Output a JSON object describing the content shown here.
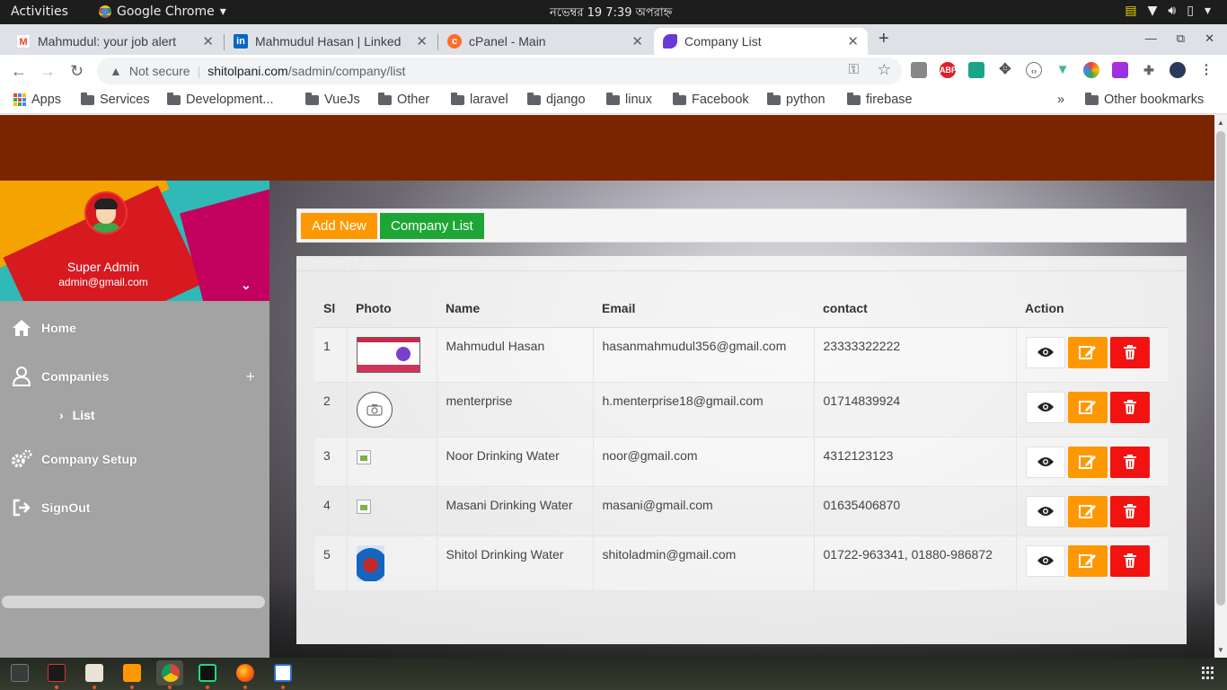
{
  "os": {
    "activities": "Activities",
    "app_menu": "Google Chrome",
    "clock": "নভেম্বর 19  7:39 অপরাহ্ন"
  },
  "tabs": [
    {
      "title": "Mahmudul: your job alert",
      "favicon": "gmail-icon"
    },
    {
      "title": "Mahmudul Hasan | Linked",
      "favicon": "linkedin-icon"
    },
    {
      "title": "cPanel - Main",
      "favicon": "cpanel-icon"
    },
    {
      "title": "Company List",
      "favicon": "site-icon",
      "active": true
    }
  ],
  "address": {
    "security": "Not secure",
    "domain": "shitolpani.com",
    "path": "/sadmin/company/list"
  },
  "bookmarks": {
    "apps": "Apps",
    "items": [
      "Services",
      "Development...",
      "VueJs",
      "Other",
      "laravel",
      "django",
      "linux",
      "Facebook",
      "python",
      "firebase"
    ],
    "overflow": "»",
    "other": "Other bookmarks"
  },
  "sidebar": {
    "user_name": "Super Admin",
    "user_email": "admin@gmail.com",
    "menu": {
      "home": "Home",
      "companies": "Companies",
      "list": "List",
      "company_setup": "Company Setup",
      "signout": "SignOut"
    }
  },
  "toolbar": {
    "add_new": "Add New",
    "company_list": "Company List"
  },
  "panel": {
    "title": "Company List"
  },
  "table": {
    "headers": {
      "sl": "Sl",
      "photo": "Photo",
      "name": "Name",
      "email": "Email",
      "contact": "contact",
      "action": "Action"
    },
    "rows": [
      {
        "sl": "1",
        "name": "Mahmudul Hasan",
        "email": "hasanmahmudul356@gmail.com",
        "contact": "23333322222",
        "photo": "website-screenshot"
      },
      {
        "sl": "2",
        "name": "menterprise",
        "email": "h.menterprise18@gmail.com",
        "contact": "01714839924",
        "photo": "camera-placeholder"
      },
      {
        "sl": "3",
        "name": "Noor Drinking Water",
        "email": "noor@gmail.com",
        "contact": "4312123123",
        "photo": "broken-image"
      },
      {
        "sl": "4",
        "name": "Masani Drinking Water",
        "email": "masani@gmail.com",
        "contact": "01635406870",
        "photo": "broken-image"
      },
      {
        "sl": "5",
        "name": "Shitol Drinking Water",
        "email": "shitoladmin@gmail.com",
        "contact": "01722-963341, 01880-986872",
        "photo": "water-drop-logo"
      }
    ]
  },
  "colors": {
    "header": "#7b2500",
    "add_new": "#ff9800",
    "company_list": "#1da635",
    "edit": "#ff9800",
    "delete": "#f21212"
  }
}
